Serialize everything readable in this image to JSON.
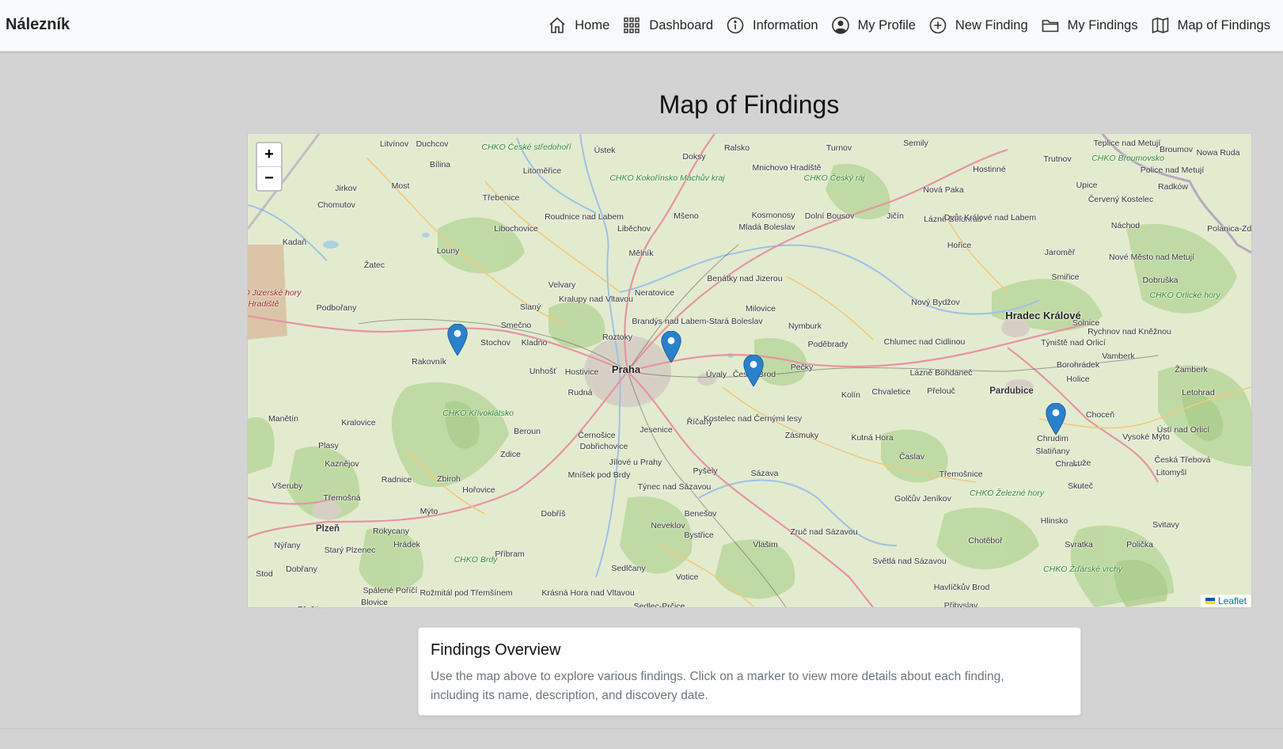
{
  "app": {
    "brand": "Nálezník"
  },
  "nav": {
    "items": [
      {
        "label": "Home",
        "icon": "house-icon"
      },
      {
        "label": "Dashboard",
        "icon": "grid-icon"
      },
      {
        "label": "Information",
        "icon": "info-icon"
      },
      {
        "label": "My Profile",
        "icon": "person-circle-icon"
      },
      {
        "label": "New Finding",
        "icon": "plus-circle-icon"
      },
      {
        "label": "My Findings",
        "icon": "folder-icon"
      },
      {
        "label": "Map of Findings",
        "icon": "map-icon"
      }
    ]
  },
  "page": {
    "title": "Map of Findings"
  },
  "map": {
    "zoom_in": "+",
    "zoom_out": "−",
    "attribution": "Leaflet",
    "marker_count": 4,
    "place_labels": [
      "Litvínov",
      "Duchcov",
      "CHKO České středohoří",
      "Ústek",
      "Doksy",
      "Ralsko",
      "Turnov",
      "Semily",
      "Teplice nad Metují",
      "Broumov",
      "Nowa Ruda",
      "Bílina",
      "Litoměřice",
      "CHKO Kokořínsko Máchův kraj",
      "Mnichovo Hradiště",
      "CHKO Český ráj",
      "Hostinné",
      "Trutnov",
      "CHKO Broumovsko",
      "Police nad Metují",
      "Jirkov",
      "Most",
      "Třebenice",
      "Nová Paka",
      "Upice",
      "Červený Kostelec",
      "Radków",
      "Chomutov",
      "Roudnice nad Labem",
      "Mšeno",
      "Kosmonosy",
      "Mladá Boleslav",
      "Dolní Bousov",
      "Jičín",
      "Lázně Bělohrad",
      "Dvůr Králové nad Labem",
      "Náchod",
      "Polanica-Zdrój",
      "Libochovice",
      "Liběchov",
      "Kadaň",
      "Louny",
      "Mělník",
      "Hořice",
      "Jaroměř",
      "Nové Město nad Metují",
      "Žatec",
      "Benátky nad Jizerou",
      "Smiřice",
      "Dobruška",
      "CHKO Orlické hory",
      "Velvary",
      "Kralupy nad Vltavou",
      "Neratovice",
      "Podbořany",
      "Slaný",
      "Milovice",
      "Nový Bydžov",
      "Hradec Králové",
      "Brandýs nad Labem-Stará Boleslav",
      "Smečno",
      "Nymburk",
      "Solnice",
      "Rychnov nad Kněžnou",
      "Stochov",
      "Kladno",
      "Roztoky",
      "Chlumec nad Cidlinou",
      "Týniště nad Orlicí",
      "Vamberk",
      "Rakovník",
      "Poděbrady",
      "Unhošť",
      "Hostivice",
      "Praha",
      "Úvaly",
      "Český Brod",
      "Pečky",
      "Lázně Bohdaneč",
      "Holice",
      "Borohrádek",
      "Žamberk",
      "Rudná",
      "Kolín",
      "Chvaletice",
      "Přelouč",
      "Pardubice",
      "Letohrad",
      "Manětín",
      "CHKO Křivoklátsko",
      "Kralovice",
      "Beroun",
      "Černošice",
      "Jesenice",
      "Říčany",
      "Kostelec nad Černými lesy",
      "Zásmuky",
      "Kutná Hora",
      "Chrudim",
      "Choceň",
      "Vysoké Mýto",
      "Ústí nad Orlicí",
      "Plasy",
      "Dobřichovice",
      "Zdice",
      "Časlav",
      "Slatiňany",
      "Chrast",
      "Luže",
      "Česká Třebová",
      "Kaznějov",
      "Jílové u Prahy",
      "Mníšek pod Brdy",
      "Zbiroh",
      "Radnice",
      "Pyšely",
      "Sázava",
      "Třemošnice",
      "Litomyšl",
      "Všeruby",
      "Třemošná",
      "Hořovice",
      "Týnec nad Sázavou",
      "Skuteč",
      "Golčův Jeníkov",
      "CHKO Železné hory",
      "Mýto",
      "Dobříš",
      "Benešov",
      "Neveklov",
      "Plzeň",
      "Rokycany",
      "Hrádek",
      "Hlinsko",
      "Svitavy",
      "Zruč nad Sázavou",
      "Bystřice",
      "Nýřany",
      "Starý Plzenec",
      "Vlašim",
      "Chotěboř",
      "Svratka",
      "Polička",
      "Příbram",
      "CHKO Brdy",
      "Světlá nad Sázavou",
      "CHKO Žďárské vrchy",
      "Stod",
      "Dobřany",
      "Sedlčany",
      "Votice",
      "Havlíčkův Brod",
      "Spálené Poříčí",
      "Rožmitál pod Třemšínem",
      "Krásná Hora nad Vltavou",
      "Blovice",
      "Přeštice",
      "Sedlec-Prčice",
      "Přibyslav",
      "CHKO Jizerské hory",
      "Hradiště"
    ]
  },
  "card": {
    "title": "Findings Overview",
    "text": "Use the map above to explore various findings. Click on a marker to view more details about each finding, including its name, description, and discovery date."
  }
}
